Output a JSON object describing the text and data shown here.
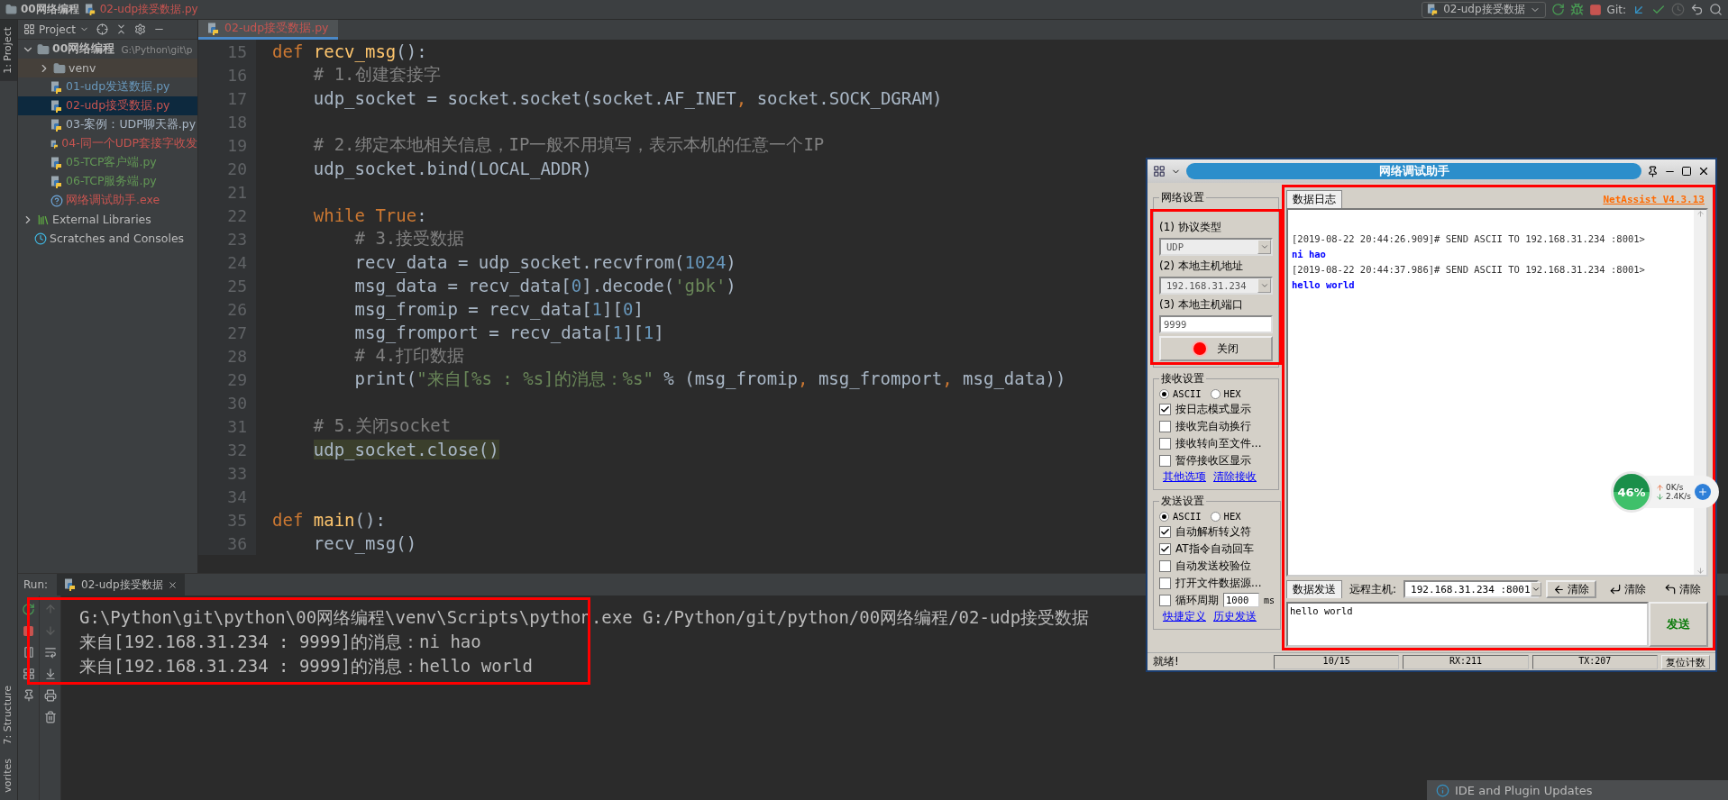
{
  "nav_bar": {
    "breadcrumbs": [
      {
        "label": "00网络编程",
        "kind": "folder"
      },
      {
        "label": "02-udp接受数据.py",
        "kind": "python"
      }
    ],
    "run_config": "02-udp接受数据",
    "vcs_label": "Git:"
  },
  "left_strip": {
    "top": [
      {
        "label": "1: Project",
        "selected": true
      }
    ],
    "bottom": [
      {
        "label": "7: Structure",
        "selected": false
      },
      {
        "label": "vorites",
        "selected": false
      }
    ]
  },
  "project": {
    "title": "Project",
    "tree": [
      {
        "label": "00网络编程",
        "path": "G:\\Python\\git\\p",
        "kind": "folder",
        "expanded": true,
        "selected": false,
        "children": [
          {
            "label": "venv",
            "kind": "excluded-folder",
            "expanded": false,
            "selected": false
          },
          {
            "label": "01-udp发送数据.py",
            "kind": "python",
            "color": "#6897bb",
            "selected": false
          },
          {
            "label": "02-udp接受数据.py",
            "kind": "python",
            "color": "#c75450",
            "selected": true
          },
          {
            "label": "03-案例：UDP聊天器.py",
            "kind": "python",
            "color": "#a9b7c6",
            "selected": false
          },
          {
            "label": "04-同一个UDP套接字收发",
            "kind": "python",
            "color": "#c75450",
            "selected": false
          },
          {
            "label": "05-TCP客户端.py",
            "kind": "python",
            "color": "#629755",
            "selected": false
          },
          {
            "label": "06-TCP服务端.py",
            "kind": "python",
            "color": "#629755",
            "selected": false
          },
          {
            "label": "网络调试助手.exe",
            "kind": "unknown",
            "color": "#c75450",
            "selected": false
          }
        ]
      },
      {
        "label": "External Libraries",
        "kind": "libraries",
        "expanded": false,
        "selected": false
      },
      {
        "label": "Scratches and Consoles",
        "kind": "scratches",
        "selected": false
      }
    ]
  },
  "editor": {
    "tabs": [
      {
        "label": "02-udp接受数据.py",
        "selected": true
      }
    ],
    "lines": [
      {
        "number": "15",
        "tokens": [
          {
            "text": "def ",
            "kind": "keyword"
          },
          {
            "text": "recv_msg",
            "kind": "function"
          },
          {
            "text": "():",
            "kind": "plain"
          }
        ]
      },
      {
        "number": "16",
        "tokens": [
          {
            "text": "    # 1.创建套接字",
            "kind": "comment"
          }
        ]
      },
      {
        "number": "17",
        "tokens": [
          {
            "text": "    udp_socket = socket.socket(socket.AF_INET",
            "kind": "plain"
          },
          {
            "text": ", ",
            "kind": "keyword"
          },
          {
            "text": "socket.SOCK_DGRAM)",
            "kind": "plain"
          }
        ]
      },
      {
        "number": "18"
      },
      {
        "number": "19",
        "tokens": [
          {
            "text": "    # 2.绑定本地相关信息，IP一般不用填写，表示本机的任意一个IP",
            "kind": "comment"
          }
        ]
      },
      {
        "number": "20",
        "tokens": [
          {
            "text": "    udp_socket.bind(LOCAL_ADDR)",
            "kind": "plain"
          }
        ]
      },
      {
        "number": "21"
      },
      {
        "number": "22",
        "tokens": [
          {
            "text": "    while True",
            "kind": "keyword"
          },
          {
            "text": ":",
            "kind": "plain"
          }
        ]
      },
      {
        "number": "23",
        "tokens": [
          {
            "text": "        # 3.接受数据",
            "kind": "comment"
          }
        ]
      },
      {
        "number": "24",
        "tokens": [
          {
            "text": "        recv_data = udp_socket.recvfrom(",
            "kind": "plain"
          },
          {
            "text": "1024",
            "kind": "number"
          },
          {
            "text": ")",
            "kind": "plain"
          }
        ]
      },
      {
        "number": "25",
        "tokens": [
          {
            "text": "        msg_data = recv_data[",
            "kind": "plain"
          },
          {
            "text": "0",
            "kind": "number"
          },
          {
            "text": "].decode(",
            "kind": "plain"
          },
          {
            "text": "'gbk'",
            "kind": "string"
          },
          {
            "text": ")",
            "kind": "plain"
          }
        ]
      },
      {
        "number": "26",
        "tokens": [
          {
            "text": "        msg_fromip = recv_data[",
            "kind": "plain"
          },
          {
            "text": "1",
            "kind": "number"
          },
          {
            "text": "][",
            "kind": "plain"
          },
          {
            "text": "0",
            "kind": "number"
          },
          {
            "text": "]",
            "kind": "plain"
          }
        ]
      },
      {
        "number": "27",
        "tokens": [
          {
            "text": "        msg_fromport = recv_data[",
            "kind": "plain"
          },
          {
            "text": "1",
            "kind": "number"
          },
          {
            "text": "][",
            "kind": "plain"
          },
          {
            "text": "1",
            "kind": "number"
          },
          {
            "text": "]",
            "kind": "plain"
          }
        ]
      },
      {
        "number": "28",
        "tokens": [
          {
            "text": "        # 4.打印数据",
            "kind": "comment"
          }
        ]
      },
      {
        "number": "29",
        "tokens": [
          {
            "text": "        print(",
            "kind": "plain"
          },
          {
            "text": "\"来自[%s : %s]的消息：%s\"",
            "kind": "string"
          },
          {
            "text": " % (msg_fromip",
            "kind": "plain"
          },
          {
            "text": ", ",
            "kind": "keyword"
          },
          {
            "text": "msg_fromport",
            "kind": "plain"
          },
          {
            "text": ", ",
            "kind": "keyword"
          },
          {
            "text": "msg_data))",
            "kind": "plain"
          }
        ]
      },
      {
        "number": "30"
      },
      {
        "number": "31",
        "tokens": [
          {
            "text": "    # 5.关闭socket",
            "kind": "comment"
          }
        ]
      },
      {
        "number": "32",
        "tokens": [
          {
            "text": "    udp_socket.close()",
            "kind": "usage"
          }
        ]
      },
      {
        "number": "33"
      },
      {
        "number": "34"
      },
      {
        "number": "35",
        "tokens": [
          {
            "text": "def ",
            "kind": "keyword"
          },
          {
            "text": "main",
            "kind": "function"
          },
          {
            "text": "():",
            "kind": "plain"
          }
        ]
      },
      {
        "number": "36",
        "tokens": [
          {
            "text": "    recv_msg()",
            "kind": "plain"
          }
        ]
      }
    ]
  },
  "run": {
    "label": "Run:",
    "tabs": [
      {
        "label": "02-udp接受数据",
        "selected": true
      }
    ],
    "output": [
      "G:\\Python\\git\\python\\00网络编程\\venv\\Scripts\\python.exe G:/Python/git/python/00网络编程/02-udp接受数据",
      "来自[192.168.31.234 : 9999]的消息：ni hao",
      "来自[192.168.31.234 : 9999]的消息：hello world"
    ]
  },
  "net_assist": {
    "title": "网络调试助手",
    "network_group": {
      "title": "网络设置",
      "protocol_label": "(1) 协议类型",
      "protocol": "UDP",
      "address_label": "(2) 本地主机地址",
      "address": "192.168.31.234",
      "port_label": "(3) 本地主机端口",
      "port": "9999",
      "connect_button": "关闭",
      "connected": true
    },
    "receive_group": {
      "title": "接收设置",
      "modes": [
        {
          "label": "ASCII",
          "selected": true
        },
        {
          "label": "HEX",
          "selected": false
        }
      ],
      "options": [
        {
          "label": "按日志模式显示",
          "checked": true
        },
        {
          "label": "接收完自动换行",
          "checked": false
        },
        {
          "label": "接收转向至文件...",
          "checked": false
        },
        {
          "label": "暂停接收区显示",
          "checked": false
        }
      ],
      "links": [
        "其他选项",
        "清除接收"
      ]
    },
    "send_group": {
      "title": "发送设置",
      "modes": [
        {
          "label": "ASCII",
          "selected": true
        },
        {
          "label": "HEX",
          "selected": false
        }
      ],
      "options": [
        {
          "label": "自动解析转义符",
          "checked": true
        },
        {
          "label": "AT指令自动回车",
          "checked": true
        },
        {
          "label": "自动发送校验位",
          "checked": false
        },
        {
          "label": "打开文件数据源...",
          "checked": false
        },
        {
          "label": "循环周期",
          "checked": false,
          "value": "1000",
          "unit": "ms"
        }
      ],
      "links": [
        "快捷定义",
        "历史发送"
      ]
    },
    "log_tabs": [
      {
        "label": "数据日志",
        "selected": true
      }
    ],
    "version": "NetAssist V4.3.13",
    "log": [
      {
        "kind": "header",
        "text": "[2019-08-22 20:44:26.909]# SEND ASCII TO 192.168.31.234 :8001>"
      },
      {
        "kind": "data",
        "text": "ni hao"
      },
      {
        "kind": "header",
        "text": "[2019-08-22 20:44:37.986]# SEND ASCII TO 192.168.31.234 :8001>"
      },
      {
        "kind": "data",
        "text": "hello world"
      }
    ],
    "send_tabs": [
      {
        "label": "数据发送",
        "selected": true
      }
    ],
    "remote_label": "远程主机:",
    "remote": "192.168.31.234 :8001",
    "clear_buttons": [
      {
        "label": "清除",
        "kind": "left"
      },
      {
        "label": "清除",
        "kind": "down-left"
      },
      {
        "label": "清除",
        "kind": "up-left"
      }
    ],
    "send_text": "hello world",
    "send_button": "发送",
    "status": {
      "text": "就绪!",
      "counts": "10/15",
      "rx": "RX:211",
      "tx": "TX:207",
      "reset_button": "复位计数"
    }
  },
  "speed_widget": {
    "percent": "46%",
    "up": "0K/s",
    "down": "2.4K/s"
  },
  "notification": {
    "title": "IDE and Plugin Updates"
  }
}
